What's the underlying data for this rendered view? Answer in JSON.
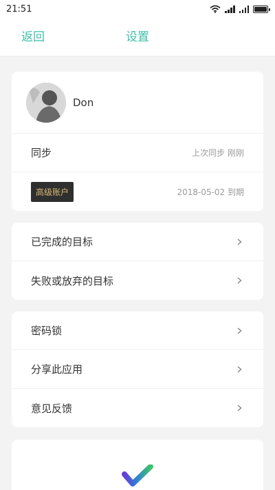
{
  "status_bar": {
    "time": "21:51"
  },
  "nav": {
    "back_label": "返回",
    "title": "设置"
  },
  "profile": {
    "name": "Don"
  },
  "sync": {
    "label": "同步",
    "status": "上次同步 刚刚"
  },
  "account": {
    "badge": "高级账户",
    "expiry": "2018-05-02 到期"
  },
  "goals": [
    {
      "label": "已完成的目标"
    },
    {
      "label": "失败或放弃的目标"
    }
  ],
  "misc": [
    {
      "label": "密码锁"
    },
    {
      "label": "分享此应用"
    },
    {
      "label": "意见反馈"
    }
  ],
  "colors": {
    "accent": "#3dbfa8",
    "badge_bg": "#2f2f2f",
    "badge_text": "#d9b872"
  },
  "icons": [
    "wifi-icon",
    "signal-icon",
    "battery-icon",
    "chevron-right-icon",
    "app-logo-check-icon"
  ]
}
